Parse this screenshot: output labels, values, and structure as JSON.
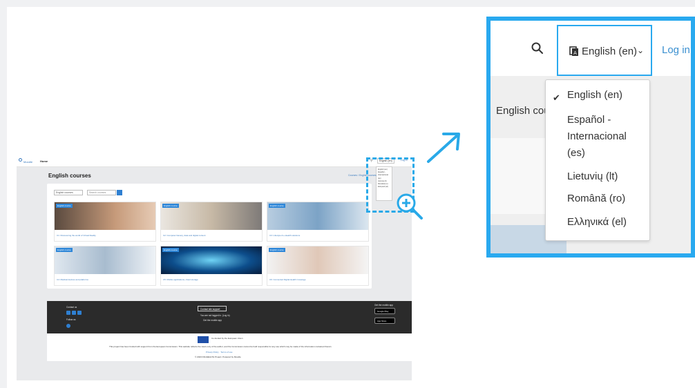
{
  "screenshot": {
    "logo_text": "Moodle",
    "nav_home": "Home",
    "header_lang": "English (en)",
    "header_login": "Log in",
    "mini_languages": [
      "English (en)",
      "Español - Internacional (es)",
      "Lietuvių (lt)",
      "Română (ro)",
      "Ελληνικά (el)"
    ],
    "page_title": "English courses",
    "breadcrumb": "Courses / English courses",
    "filter_select": "English courses",
    "filter_search_placeholder": "Search courses",
    "tag": "English course",
    "courses": [
      "C1: Discovering the world of Virtual Reality",
      "C2: Computer literacy, data and digital content",
      "C3: Lifestyle & e-Health solutions",
      "C4: Medical devices and platforms",
      "C5: Mobile applications, cloud storage",
      "C6: Connected Digital Health Coverage"
    ],
    "footer": {
      "contact": "Contact us",
      "follow": "Follow us",
      "support_button": "Contact site support",
      "not_logged": "You are not logged in. (Log in)",
      "mobile_app": "Get the mobile app",
      "get_app": "Get the mobile app",
      "google_play": "Google Play",
      "app_store": "App Store"
    },
    "eu": {
      "cofunded": "Co-funded by the European Union",
      "disclaimer": "This project has been funded with support from the European Commission. This website reflects the views only of the author, and the Commission cannot be held responsible for any use which may be made of the information contained therein.",
      "links": "Privacy Policy · Terms of use",
      "copyright": "© 2023 DIGIHEALTH Project. Powered by Moodle"
    }
  },
  "zoom": {
    "lang_button": "English (en)",
    "login": "Log in",
    "course_fragment": "English cou",
    "languages": [
      "English (en)",
      "Español -",
      "Internacional",
      "(es)",
      "Lietuvių (lt)",
      "Română (ro)",
      "Ελληνικά (el)"
    ],
    "selected_check": "✔"
  },
  "colors": {
    "accent": "#29a9ef",
    "link": "#3a8fd0",
    "footer_bg": "#2b2b2b"
  }
}
